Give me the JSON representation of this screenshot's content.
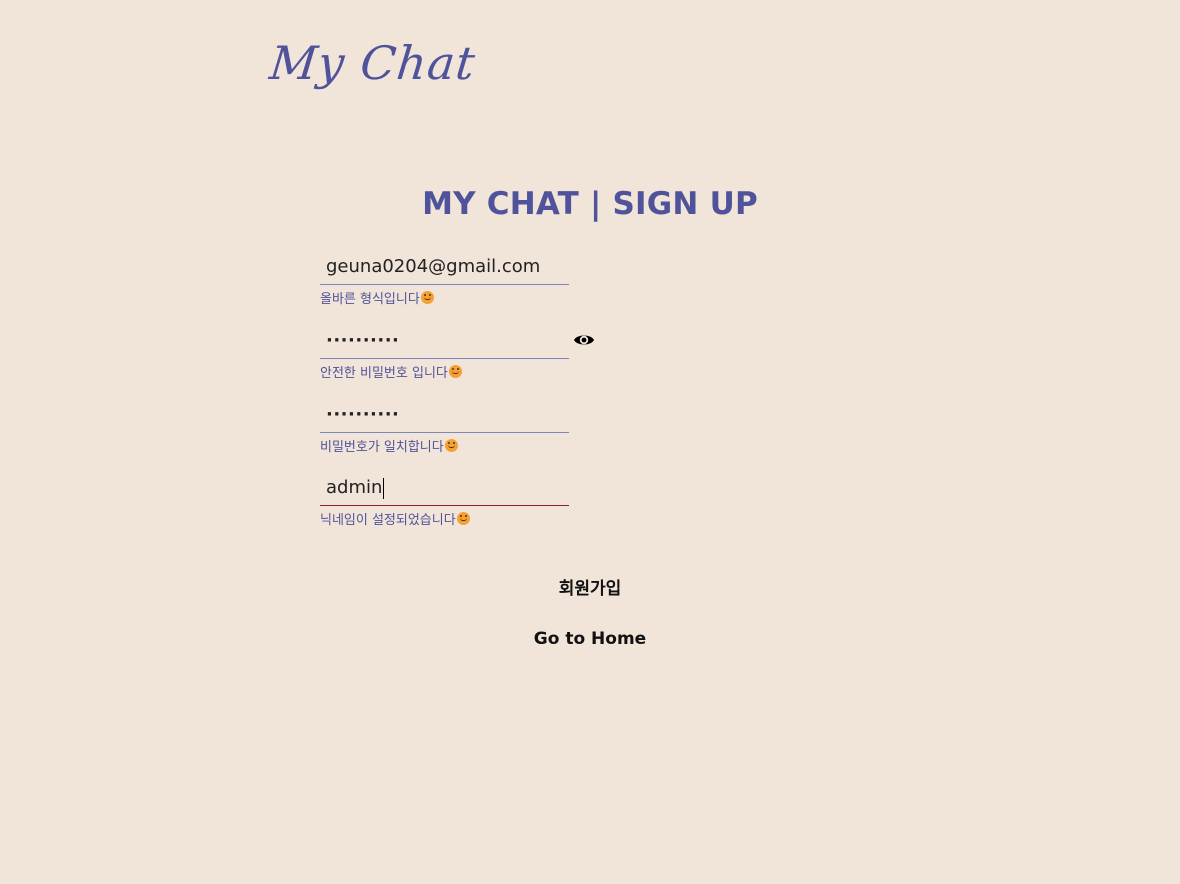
{
  "header": {
    "logo_text": "My Chat"
  },
  "title": "MY CHAT | SIGN UP",
  "form": {
    "email": {
      "value": "geuna0204@gmail.com",
      "message": "올바른 형식입니다"
    },
    "password": {
      "value": "··········",
      "message": "안전한 비밀번호 입니다"
    },
    "password_confirm": {
      "value": "··········",
      "message": "비밀번호가 일치합니다"
    },
    "nickname": {
      "value": "admin",
      "message": "닉네임이 설정되었습니다"
    }
  },
  "actions": {
    "signup_label": "회원가입",
    "home_label": "Go to Home"
  },
  "icons": {
    "toggle_password": "eye-icon",
    "message_emoji": "smiling-face-icon"
  },
  "colors": {
    "background": "#f1e4d8",
    "accent": "#50539b",
    "active_underline": "#8b1f2a",
    "emoji": "#f3a135"
  }
}
